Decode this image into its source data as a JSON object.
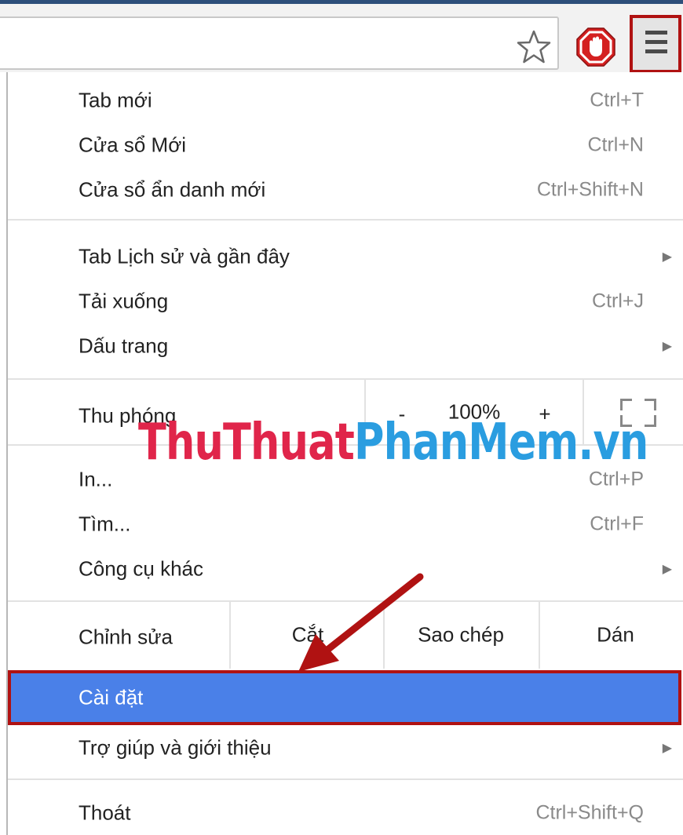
{
  "toolbar": {
    "icons": [
      "star-icon",
      "stop-hand-icon",
      "hamburger-menu-icon"
    ]
  },
  "menu": {
    "new_tab": {
      "label": "Tab mới",
      "shortcut": "Ctrl+T"
    },
    "new_window": {
      "label": "Cửa sổ Mới",
      "shortcut": "Ctrl+N"
    },
    "incognito": {
      "label": "Cửa sổ ẩn danh mới",
      "shortcut": "Ctrl+Shift+N"
    },
    "history": {
      "label": "Tab Lịch sử và gần đây"
    },
    "downloads": {
      "label": "Tải xuống",
      "shortcut": "Ctrl+J"
    },
    "bookmarks": {
      "label": "Dấu trang"
    },
    "zoom": {
      "label": "Thu phóng",
      "minus": "-",
      "value": "100%",
      "plus": "+"
    },
    "print": {
      "label": "In...",
      "shortcut": "Ctrl+P"
    },
    "find": {
      "label": "Tìm...",
      "shortcut": "Ctrl+F"
    },
    "more_tools": {
      "label": "Công cụ khác"
    },
    "edit": {
      "label": "Chỉnh sửa",
      "cut": "Cắt",
      "copy": "Sao chép",
      "paste": "Dán"
    },
    "settings": {
      "label": "Cài đặt"
    },
    "help": {
      "label": "Trợ giúp và giới thiệu"
    },
    "exit": {
      "label": "Thoát",
      "shortcut": "Ctrl+Shift+Q"
    }
  },
  "watermark": {
    "part1": "ThuThuat",
    "part2": "PhanMem.vn"
  },
  "colors": {
    "highlight": "#4a80e8",
    "annotation_red": "#b01212",
    "watermark_red": "#e0254a",
    "watermark_blue": "#2a9de0"
  }
}
